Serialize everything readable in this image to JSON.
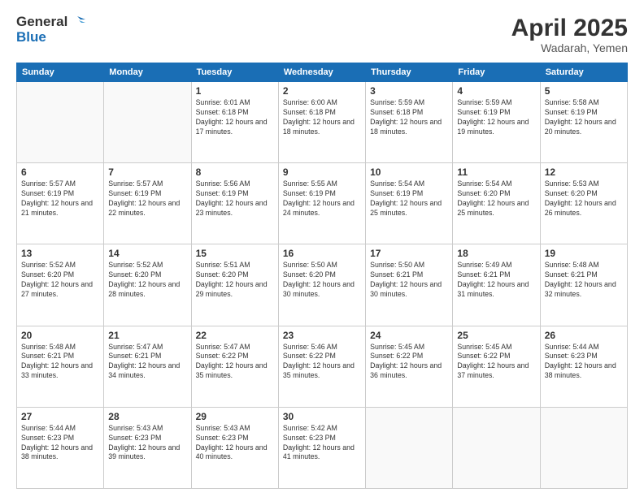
{
  "header": {
    "logo_line1": "General",
    "logo_line2": "Blue",
    "month_year": "April 2025",
    "location": "Wadarah, Yemen"
  },
  "weekdays": [
    "Sunday",
    "Monday",
    "Tuesday",
    "Wednesday",
    "Thursday",
    "Friday",
    "Saturday"
  ],
  "weeks": [
    [
      {
        "day": "",
        "sunrise": "",
        "sunset": "",
        "daylight": ""
      },
      {
        "day": "",
        "sunrise": "",
        "sunset": "",
        "daylight": ""
      },
      {
        "day": "1",
        "sunrise": "Sunrise: 6:01 AM",
        "sunset": "Sunset: 6:18 PM",
        "daylight": "Daylight: 12 hours and 17 minutes."
      },
      {
        "day": "2",
        "sunrise": "Sunrise: 6:00 AM",
        "sunset": "Sunset: 6:18 PM",
        "daylight": "Daylight: 12 hours and 18 minutes."
      },
      {
        "day": "3",
        "sunrise": "Sunrise: 5:59 AM",
        "sunset": "Sunset: 6:18 PM",
        "daylight": "Daylight: 12 hours and 18 minutes."
      },
      {
        "day": "4",
        "sunrise": "Sunrise: 5:59 AM",
        "sunset": "Sunset: 6:19 PM",
        "daylight": "Daylight: 12 hours and 19 minutes."
      },
      {
        "day": "5",
        "sunrise": "Sunrise: 5:58 AM",
        "sunset": "Sunset: 6:19 PM",
        "daylight": "Daylight: 12 hours and 20 minutes."
      }
    ],
    [
      {
        "day": "6",
        "sunrise": "Sunrise: 5:57 AM",
        "sunset": "Sunset: 6:19 PM",
        "daylight": "Daylight: 12 hours and 21 minutes."
      },
      {
        "day": "7",
        "sunrise": "Sunrise: 5:57 AM",
        "sunset": "Sunset: 6:19 PM",
        "daylight": "Daylight: 12 hours and 22 minutes."
      },
      {
        "day": "8",
        "sunrise": "Sunrise: 5:56 AM",
        "sunset": "Sunset: 6:19 PM",
        "daylight": "Daylight: 12 hours and 23 minutes."
      },
      {
        "day": "9",
        "sunrise": "Sunrise: 5:55 AM",
        "sunset": "Sunset: 6:19 PM",
        "daylight": "Daylight: 12 hours and 24 minutes."
      },
      {
        "day": "10",
        "sunrise": "Sunrise: 5:54 AM",
        "sunset": "Sunset: 6:19 PM",
        "daylight": "Daylight: 12 hours and 25 minutes."
      },
      {
        "day": "11",
        "sunrise": "Sunrise: 5:54 AM",
        "sunset": "Sunset: 6:20 PM",
        "daylight": "Daylight: 12 hours and 25 minutes."
      },
      {
        "day": "12",
        "sunrise": "Sunrise: 5:53 AM",
        "sunset": "Sunset: 6:20 PM",
        "daylight": "Daylight: 12 hours and 26 minutes."
      }
    ],
    [
      {
        "day": "13",
        "sunrise": "Sunrise: 5:52 AM",
        "sunset": "Sunset: 6:20 PM",
        "daylight": "Daylight: 12 hours and 27 minutes."
      },
      {
        "day": "14",
        "sunrise": "Sunrise: 5:52 AM",
        "sunset": "Sunset: 6:20 PM",
        "daylight": "Daylight: 12 hours and 28 minutes."
      },
      {
        "day": "15",
        "sunrise": "Sunrise: 5:51 AM",
        "sunset": "Sunset: 6:20 PM",
        "daylight": "Daylight: 12 hours and 29 minutes."
      },
      {
        "day": "16",
        "sunrise": "Sunrise: 5:50 AM",
        "sunset": "Sunset: 6:20 PM",
        "daylight": "Daylight: 12 hours and 30 minutes."
      },
      {
        "day": "17",
        "sunrise": "Sunrise: 5:50 AM",
        "sunset": "Sunset: 6:21 PM",
        "daylight": "Daylight: 12 hours and 30 minutes."
      },
      {
        "day": "18",
        "sunrise": "Sunrise: 5:49 AM",
        "sunset": "Sunset: 6:21 PM",
        "daylight": "Daylight: 12 hours and 31 minutes."
      },
      {
        "day": "19",
        "sunrise": "Sunrise: 5:48 AM",
        "sunset": "Sunset: 6:21 PM",
        "daylight": "Daylight: 12 hours and 32 minutes."
      }
    ],
    [
      {
        "day": "20",
        "sunrise": "Sunrise: 5:48 AM",
        "sunset": "Sunset: 6:21 PM",
        "daylight": "Daylight: 12 hours and 33 minutes."
      },
      {
        "day": "21",
        "sunrise": "Sunrise: 5:47 AM",
        "sunset": "Sunset: 6:21 PM",
        "daylight": "Daylight: 12 hours and 34 minutes."
      },
      {
        "day": "22",
        "sunrise": "Sunrise: 5:47 AM",
        "sunset": "Sunset: 6:22 PM",
        "daylight": "Daylight: 12 hours and 35 minutes."
      },
      {
        "day": "23",
        "sunrise": "Sunrise: 5:46 AM",
        "sunset": "Sunset: 6:22 PM",
        "daylight": "Daylight: 12 hours and 35 minutes."
      },
      {
        "day": "24",
        "sunrise": "Sunrise: 5:45 AM",
        "sunset": "Sunset: 6:22 PM",
        "daylight": "Daylight: 12 hours and 36 minutes."
      },
      {
        "day": "25",
        "sunrise": "Sunrise: 5:45 AM",
        "sunset": "Sunset: 6:22 PM",
        "daylight": "Daylight: 12 hours and 37 minutes."
      },
      {
        "day": "26",
        "sunrise": "Sunrise: 5:44 AM",
        "sunset": "Sunset: 6:23 PM",
        "daylight": "Daylight: 12 hours and 38 minutes."
      }
    ],
    [
      {
        "day": "27",
        "sunrise": "Sunrise: 5:44 AM",
        "sunset": "Sunset: 6:23 PM",
        "daylight": "Daylight: 12 hours and 38 minutes."
      },
      {
        "day": "28",
        "sunrise": "Sunrise: 5:43 AM",
        "sunset": "Sunset: 6:23 PM",
        "daylight": "Daylight: 12 hours and 39 minutes."
      },
      {
        "day": "29",
        "sunrise": "Sunrise: 5:43 AM",
        "sunset": "Sunset: 6:23 PM",
        "daylight": "Daylight: 12 hours and 40 minutes."
      },
      {
        "day": "30",
        "sunrise": "Sunrise: 5:42 AM",
        "sunset": "Sunset: 6:23 PM",
        "daylight": "Daylight: 12 hours and 41 minutes."
      },
      {
        "day": "",
        "sunrise": "",
        "sunset": "",
        "daylight": ""
      },
      {
        "day": "",
        "sunrise": "",
        "sunset": "",
        "daylight": ""
      },
      {
        "day": "",
        "sunrise": "",
        "sunset": "",
        "daylight": ""
      }
    ]
  ]
}
